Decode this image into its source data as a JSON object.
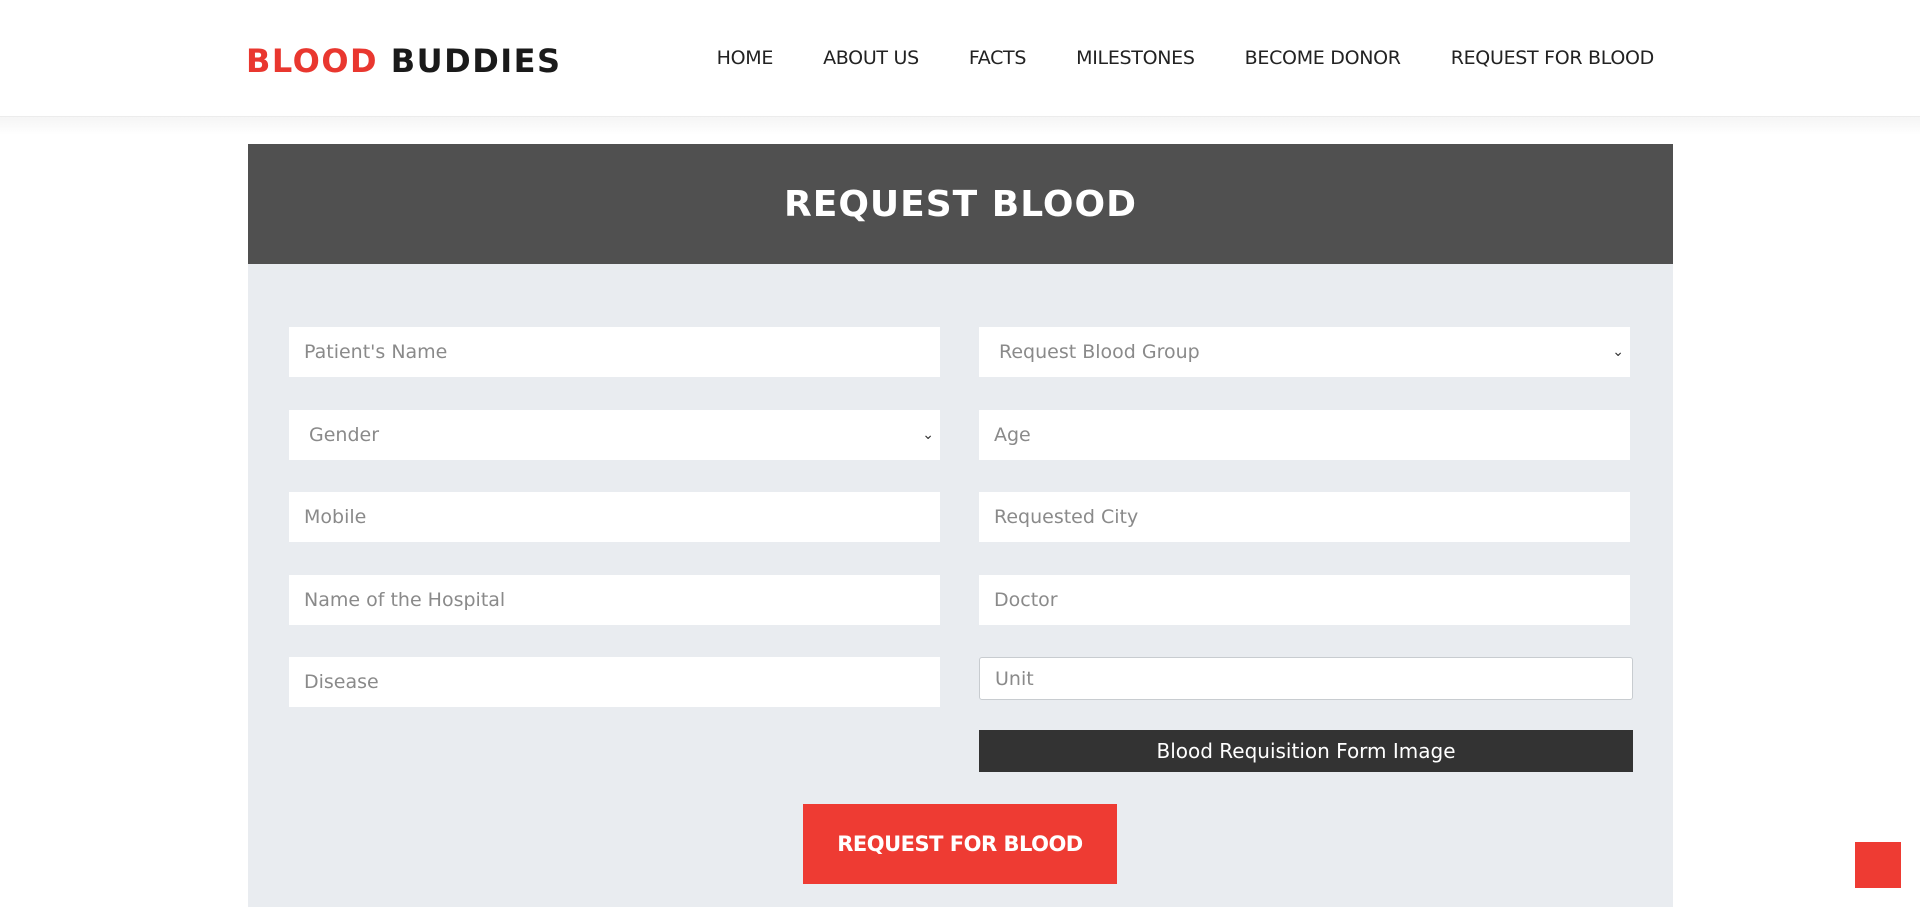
{
  "brand": {
    "part1": "BLOOD",
    "part2": "BUDDIES",
    "accent_color": "#e9372f"
  },
  "nav": {
    "items": [
      "HOME",
      "ABOUT US",
      "FACTS",
      "MILESTONES",
      "BECOME DONOR",
      "REQUEST FOR BLOOD"
    ]
  },
  "form": {
    "title": "REQUEST BLOOD",
    "patient_name_placeholder": "Patient's Name",
    "blood_group_selected": "Request Blood Group",
    "gender_selected": "Gender",
    "age_placeholder": "Age",
    "mobile_placeholder": "Mobile",
    "city_placeholder": "Requested City",
    "hospital_placeholder": "Name of the Hospital",
    "doctor_placeholder": "Doctor",
    "disease_placeholder": "Disease",
    "unit_placeholder": "Unit",
    "file_button_label": "Blood Requisition Form Image",
    "submit_label": "REQUEST FOR BLOOD",
    "icons": {
      "select_arrow": "chevron-down-icon"
    },
    "colors": {
      "header_bg": "#505050",
      "body_bg": "#e9ecf0",
      "submit_bg": "#ee3b33",
      "file_bg": "#333333"
    }
  }
}
